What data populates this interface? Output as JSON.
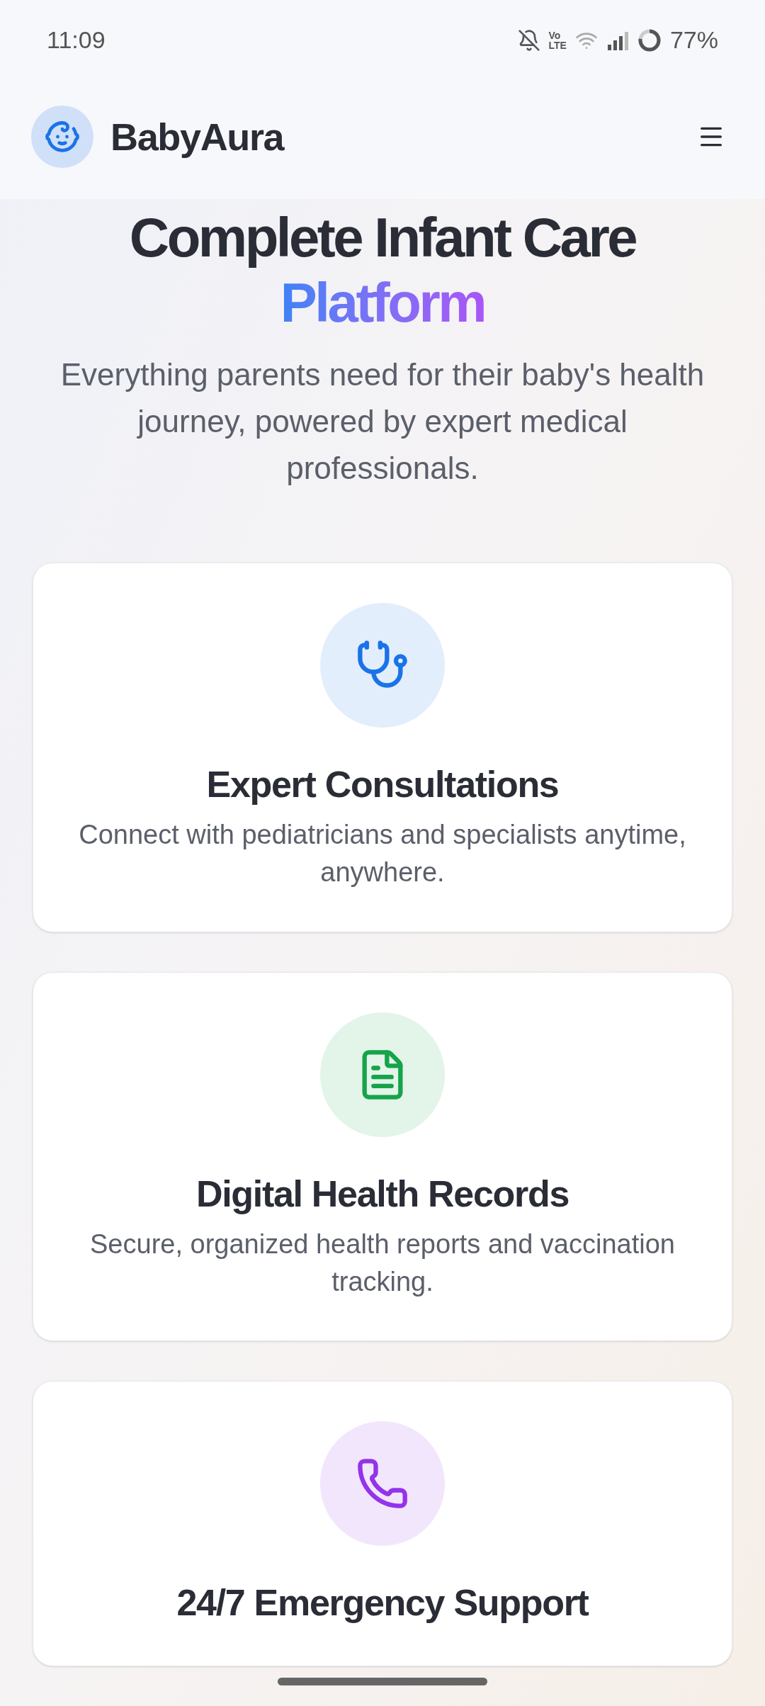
{
  "status_bar": {
    "time": "11:09",
    "volte_top": "Vo",
    "volte_bottom": "LTE",
    "battery": "77%"
  },
  "header": {
    "brand": "BabyAura"
  },
  "hero": {
    "title": "Complete Infant Care",
    "title_highlight": "Platform",
    "subtitle": "Everything parents need for their baby's health journey, powered by expert medical professionals."
  },
  "features": [
    {
      "kind": "stethoscope",
      "color": "#1a73e8",
      "title": "Expert Consultations",
      "description": "Connect with pediatricians and specialists anytime, anywhere."
    },
    {
      "kind": "document",
      "color": "#16a34a",
      "title": "Digital Health Records",
      "description": "Secure, organized health reports and vaccination tracking."
    },
    {
      "kind": "phone",
      "color": "#9333ea",
      "title": "24/7 Emergency Support"
    }
  ]
}
